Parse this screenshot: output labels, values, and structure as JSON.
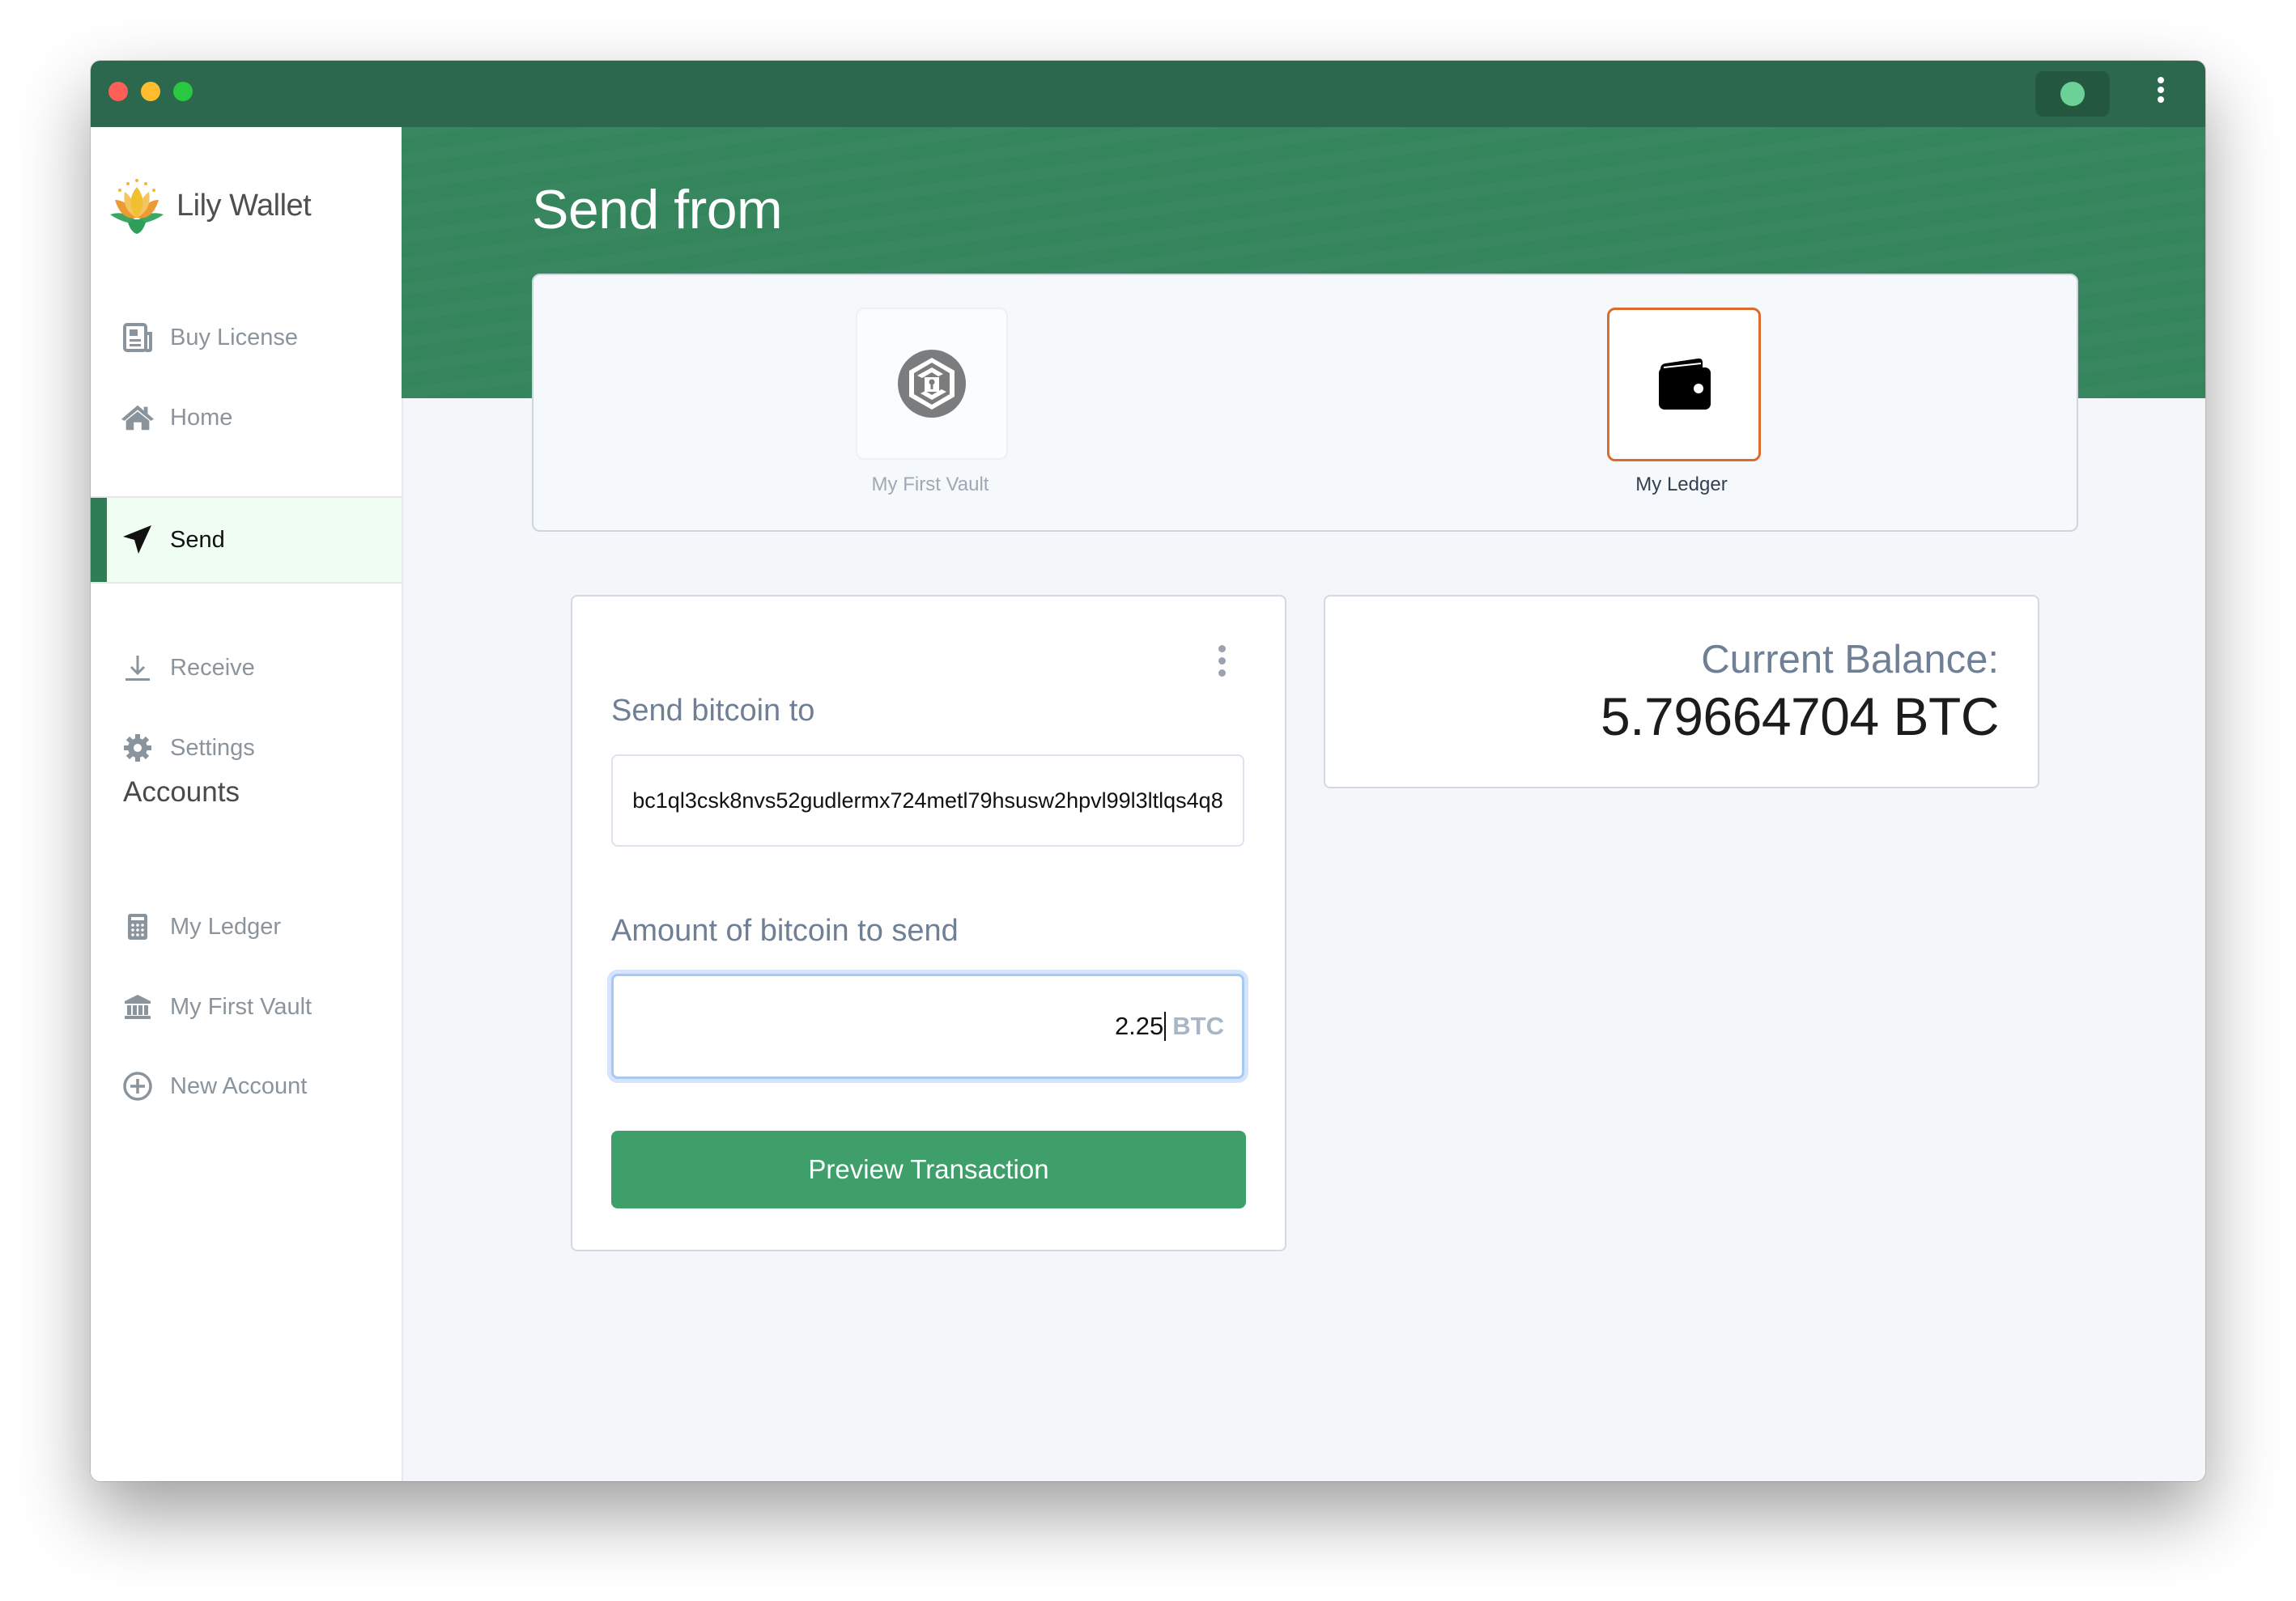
{
  "app": {
    "name": "Lily Wallet",
    "status_color": "#6bd196",
    "accent_color": "#34845c"
  },
  "sidebar": {
    "nav": [
      {
        "label": "Buy License",
        "icon": "newspaper-icon",
        "active": false
      },
      {
        "label": "Home",
        "icon": "home-icon",
        "active": false
      },
      {
        "label": "Send",
        "icon": "send-icon",
        "active": true
      },
      {
        "label": "Receive",
        "icon": "download-icon",
        "active": false
      },
      {
        "label": "Settings",
        "icon": "gear-icon",
        "active": false
      }
    ],
    "accounts_heading": "Accounts",
    "accounts": [
      {
        "label": "My Ledger",
        "icon": "calculator-icon"
      },
      {
        "label": "My First Vault",
        "icon": "bank-icon"
      },
      {
        "label": "New Account",
        "icon": "plus-circle-icon"
      }
    ]
  },
  "main": {
    "title": "Send from",
    "send_from": [
      {
        "label": "My First Vault",
        "icon": "vault-lock-icon",
        "selected": false
      },
      {
        "label": "My Ledger",
        "icon": "wallet-icon",
        "selected": true,
        "highlight_color": "#dd6b2c"
      }
    ],
    "form": {
      "address_label": "Send bitcoin to",
      "address_value": "bc1ql3csk8nvs52gudlermx724metl79hsusw2hpvl99l3ltlqs4q8",
      "amount_label": "Amount of bitcoin to send",
      "amount_value": "2.25",
      "amount_unit": "BTC",
      "submit_label": "Preview Transaction"
    },
    "balance": {
      "label": "Current Balance:",
      "value": "5.79664704 BTC"
    }
  }
}
